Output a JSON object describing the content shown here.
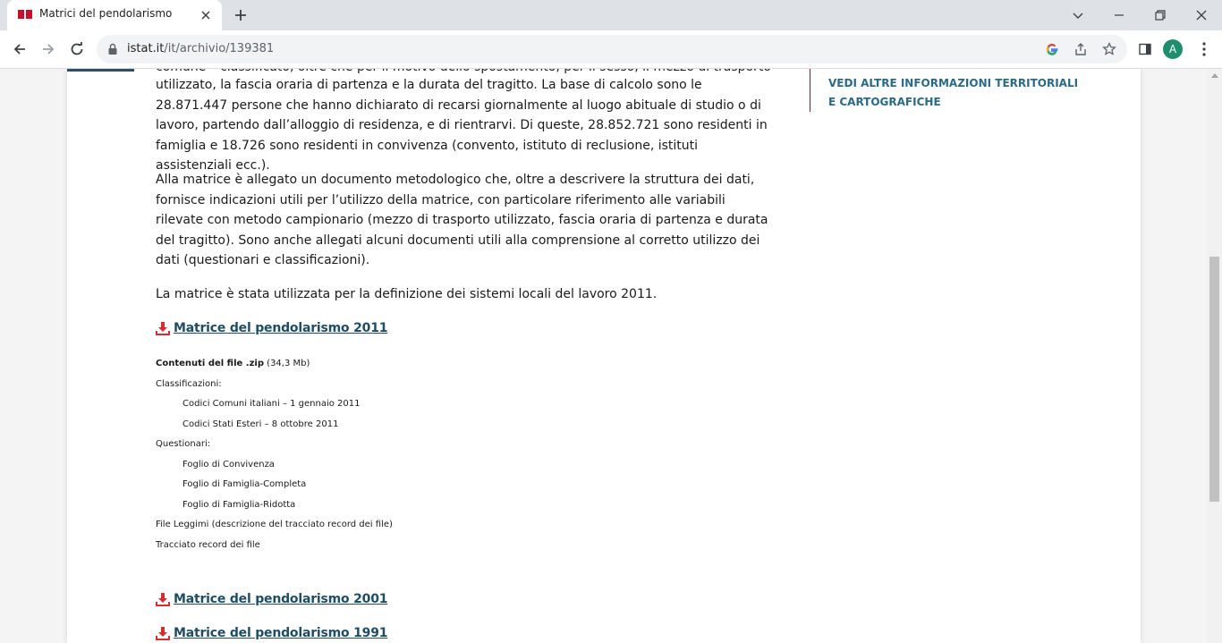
{
  "browser": {
    "tab_title": "Matrici del pendolarismo",
    "url_host": "istat.it",
    "url_path": "/it/archivio/139381",
    "avatar_letter": "A",
    "icons": [
      "istat-favicon",
      "close-icon",
      "plus-icon",
      "chevron-down-icon",
      "minimize-icon",
      "restore-icon",
      "close-icon",
      "back-arrow-icon",
      "forward-arrow-icon",
      "reload-icon",
      "lock-icon",
      "google-icon",
      "share-icon",
      "star-icon",
      "side-panel-icon"
    ]
  },
  "article": {
    "cut_line": "comune – classificato, oltre che per il motivo dello spostamento, per il sesso, il mezzo di trasporto",
    "para1": "utilizzato, la fascia oraria di partenza e la durata del tragitto. La base di calcolo sono le 28.871.447 persone che hanno dichiarato di recarsi giornalmente al luogo abituale di studio o di lavoro, partendo dall’alloggio di residenza, e di rientrarvi. Di queste, 28.852.721 sono residenti in famiglia e 18.726 sono residenti in convivenza (convento, istituto di reclusione, istituti assistenziali ecc.).",
    "para2": "Alla matrice è allegato un documento metodologico che, oltre a descrivere la struttura dei dati, fornisce indicazioni utili per l’utilizzo della matrice, con particolare riferimento alle variabili rilevate con metodo campionario (mezzo di trasporto utilizzato, fascia oraria di partenza e durata del tragitto). Sono anche allegati alcuni documenti utili alla comprensione al corretto utilizzo dei dati (questionari e classificazioni).",
    "para3": "La matrice è stata utilizzata per la definizione dei sistemi locali del lavoro 2011.",
    "download_2011": "Matrice del pendolarismo 2011",
    "download_2001": "Matrice del pendolarismo 2001",
    "download_1991": "Matrice del pendolarismo 1991",
    "zip_contents_label": "Contenuti del file .zip",
    "zip_size": " (34,3 Mb)",
    "classificazioni_label": "Classificazioni:",
    "classificazioni_items": [
      "Codici Comuni italiani – 1 gennaio 2011",
      "Codici Stati Esteri – 8 ottobre 2011"
    ],
    "questionari_label": "Questionari:",
    "questionari_items": [
      "Foglio di Convivenza",
      "Foglio di Famiglia-Completa",
      "Foglio di Famiglia-Ridotta"
    ],
    "file_leggimi": "File Leggimi (descrizione del tracciato record dei file)",
    "tracciato": "Tracciato record dei file"
  },
  "sidebar": {
    "link_text": "Vedi altre informazioni territoriali e cartografiche"
  },
  "colors": {
    "link": "#1f4e64",
    "sidebar_link": "#2b6a86",
    "accent_red": "#d32f2f"
  }
}
